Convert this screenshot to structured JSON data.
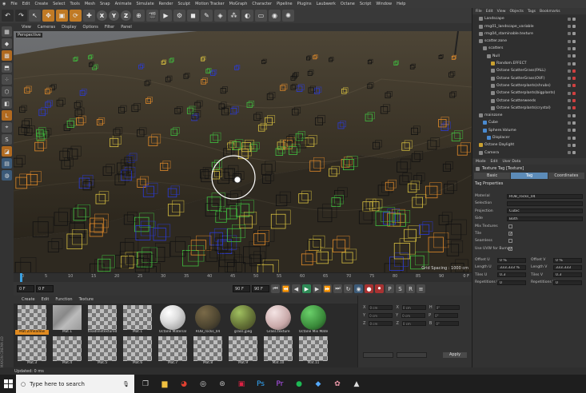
{
  "menu": [
    "File",
    "Edit",
    "Create",
    "Select",
    "Tools",
    "Mesh",
    "Snap",
    "Animate",
    "Simulate",
    "Render",
    "Sculpt",
    "Motion Tracker",
    "MoGraph",
    "Character",
    "Pipeline",
    "Plugins",
    "Laubwerk",
    "Octane",
    "Script",
    "Window",
    "Help"
  ],
  "toolbar": {
    "axes": [
      "X",
      "Y",
      "Z"
    ]
  },
  "viewport": {
    "menu": [
      "View",
      "Cameras",
      "Display",
      "Options",
      "Filter",
      "Panel"
    ],
    "label": "Perspective",
    "grid_spacing": "Grid Spacing : 1000 cm"
  },
  "timeline": {
    "ticks": [
      "0",
      "5",
      "10",
      "15",
      "20",
      "25",
      "30",
      "35",
      "40",
      "45",
      "50",
      "55",
      "60",
      "65",
      "70",
      "75",
      "80",
      "85",
      "90"
    ],
    "end_label": "0 F",
    "start_field": "0 F",
    "current_field": "0 F",
    "end_field": "90 F",
    "max_field": "90 F"
  },
  "materials": {
    "menu": [
      "Create",
      "Edit",
      "Function",
      "Texture"
    ],
    "items": [
      {
        "label": "Mat.2/meadow",
        "type": "checker",
        "selected": true
      },
      {
        "label": "Mat.1",
        "type": "stone"
      },
      {
        "label": "headlinetextured",
        "type": "checker"
      },
      {
        "label": "Mat.1",
        "type": "checker"
      },
      {
        "label": "Octane Material",
        "type": "white"
      },
      {
        "label": "ROB_rocks_04",
        "type": "rock"
      },
      {
        "label": "grass.jpeg",
        "type": "grass"
      },
      {
        "label": "Grass.texture",
        "type": "pale"
      },
      {
        "label": "Octane Mix Mate",
        "type": "mix"
      },
      {
        "label": "Mat.3",
        "type": "checker"
      },
      {
        "label": "Mat.4",
        "type": "checker"
      },
      {
        "label": "Mat.5",
        "type": "checker"
      },
      {
        "label": "Mat.6",
        "type": "checker"
      },
      {
        "label": "Mat.7",
        "type": "checker"
      },
      {
        "label": "Mat.8",
        "type": "checker"
      },
      {
        "label": "Mat.9",
        "type": "checker"
      },
      {
        "label": "Mat.10",
        "type": "checker"
      },
      {
        "label": "Mat.11",
        "type": "checker"
      }
    ]
  },
  "coords": {
    "rows": [
      [
        "X",
        "0 cm",
        "X",
        "0 cm",
        "H",
        "0°"
      ],
      [
        "Y",
        "0 cm",
        "Y",
        "0 cm",
        "P",
        "0°"
      ],
      [
        "Z",
        "0 cm",
        "Z",
        "0 cm",
        "B",
        "0°"
      ]
    ],
    "apply": "Apply"
  },
  "object_manager": {
    "menu": [
      "File",
      "Edit",
      "View",
      "Objects",
      "Tags",
      "Bookmarks"
    ],
    "rows": [
      {
        "label": "Landscape",
        "indent": 1,
        "icon": "g"
      },
      {
        "label": "rmg01_landscape_variable",
        "indent": 1,
        "icon": "g"
      },
      {
        "label": "rmg04_staminable.texture",
        "indent": 1,
        "icon": "g"
      },
      {
        "label": "scatter.zone",
        "indent": 1,
        "icon": "g"
      },
      {
        "label": "scatters",
        "indent": 2,
        "icon": "g"
      },
      {
        "label": "Null",
        "indent": 3,
        "icon": "g"
      },
      {
        "label": "Random.EFFECT",
        "indent": 4,
        "icon": "y"
      },
      {
        "label": "Octane ScatterGrass(FALL)",
        "indent": 4,
        "icon": "g",
        "red": true
      },
      {
        "label": "Octane ScatterGrass(OVF)",
        "indent": 4,
        "icon": "g",
        "red": true
      },
      {
        "label": "Octane Scatterplants(shrubs)",
        "indent": 4,
        "icon": "g",
        "red": true
      },
      {
        "label": "Octane Scatterplants(bigplants)",
        "indent": 4,
        "icon": "g",
        "red": true
      },
      {
        "label": "Octane Scatterweeds",
        "indent": 4,
        "icon": "g",
        "red": true
      },
      {
        "label": "Octane Scatterplants(crystal)",
        "indent": 4,
        "icon": "g",
        "red": true
      },
      {
        "label": "mainzone",
        "indent": 1,
        "icon": "g"
      },
      {
        "label": "Cube",
        "indent": 2,
        "icon": "b"
      },
      {
        "label": "Sphere.Volume",
        "indent": 2,
        "icon": "b"
      },
      {
        "label": "Displacer",
        "indent": 3,
        "icon": "b"
      },
      {
        "label": "Octane Daylight",
        "indent": 1,
        "icon": "y"
      },
      {
        "label": "Camera",
        "indent": 1,
        "icon": "g"
      }
    ]
  },
  "attributes": {
    "menu": [
      "Mode",
      "Edit",
      "User Data"
    ],
    "title": "Texture Tag [Texture]",
    "tabs": [
      "Basic",
      "Tag",
      "Coordinates"
    ],
    "active_tab": "Tag",
    "section": "Tag Properties",
    "rows": [
      {
        "label": "Material",
        "value": "ROB_rocks_04"
      },
      {
        "label": "Selection",
        "value": ""
      },
      {
        "label": "Projection",
        "value": "Cubic"
      },
      {
        "label": "Side",
        "value": "Both"
      },
      {
        "label": "Mix Textures",
        "check": ""
      },
      {
        "label": "Tile",
        "check": "✓"
      },
      {
        "label": "Seamless",
        "check": ""
      },
      {
        "label": "Use UVW for Bump",
        "check": "✓"
      }
    ],
    "pairs": [
      {
        "l1": "Offset U",
        "v1": "0 %",
        "l2": "Offset V",
        "v2": "0 %"
      },
      {
        "l1": "Length U",
        "v1": "333.333 %",
        "l2": "Length V",
        "v2": "333.333"
      },
      {
        "l1": "Tiles U",
        "v1": "0.3",
        "l2": "Tiles V",
        "v2": "0.3"
      },
      {
        "l1": "Repetitions U",
        "v1": "0",
        "l2": "Repetitions V",
        "v2": "0"
      }
    ]
  },
  "status": "Updated: 0 ms",
  "taskbar": {
    "search_placeholder": "Type here to search"
  },
  "side_brand": "MAXON CINEMA 4D"
}
